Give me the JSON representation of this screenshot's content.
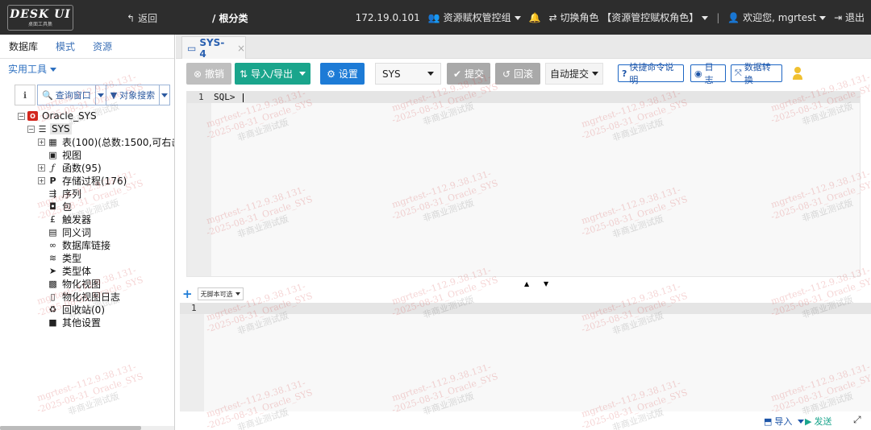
{
  "app": {
    "logo_text": "DESK UI",
    "logo_sub": "桌面工具集",
    "back_label": "返回",
    "page_title": "/ 根分类",
    "ip": "172.19.0.101",
    "group_label": "资源赋权管控组",
    "switch_role_label": "切换角色",
    "current_role": "【资源管控赋权角色】",
    "welcome_label": "欢迎您,",
    "username": "mgrtest",
    "logout_label": "退出"
  },
  "left": {
    "tabs": [
      "数据库",
      "模式",
      "资源"
    ],
    "tools_label": "实用工具",
    "query_window_label": "查询窗口",
    "object_search_label": "对象搜索",
    "tree": {
      "root": "Oracle_SYS",
      "schema": "SYS",
      "items": [
        "表(100)(总数:1500,可右击",
        "视图",
        "函数(95)",
        "存储过程(176)",
        "序列",
        "包",
        "触发器",
        "同义词",
        "数据库链接",
        "类型",
        "类型体",
        "物化视图",
        "物化视图日志",
        "回收站(0)",
        "其他设置"
      ]
    }
  },
  "main": {
    "tab_label": "SYS-4",
    "toolbar": {
      "cancel": "撤销",
      "import_export": "导入/导出",
      "settings": "设置",
      "schema_select": "SYS",
      "commit": "提交",
      "rollback": "回滚",
      "auto_commit": "自动提交",
      "shortcut_help": "快捷命令说明",
      "log": "日志",
      "data_convert": "数据转换"
    },
    "editor": {
      "line_number": "1",
      "code": "SQL> "
    },
    "result": {
      "select_label": "无脚本可选",
      "line_number": "1"
    },
    "bottom": {
      "import": "导入",
      "send": "发送"
    }
  },
  "watermark": {
    "line1": "mgrtest--112.9.38.131-",
    "line2": "-2025-08-31_Oracle_SYS",
    "line3": "非商业测试版"
  },
  "colors": {
    "topbar": "#2d2d2d",
    "accent_blue": "#1d7bd6",
    "accent_green": "#1aa58c",
    "oracle_red": "#d3271e"
  }
}
